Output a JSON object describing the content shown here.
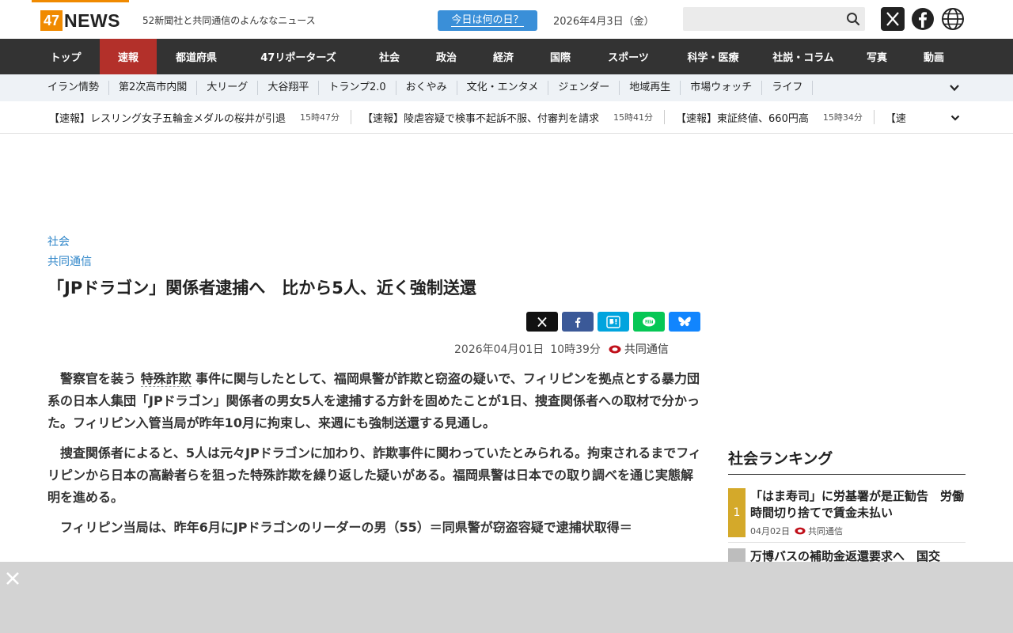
{
  "header": {
    "logo_num": "47",
    "logo_word": "NEWS",
    "tagline": "52新聞社と共同通信のよんななニュース",
    "today_button": "今日は何の日？",
    "date": "2026年4月3日（金）",
    "search_placeholder": ""
  },
  "main_nav": [
    {
      "label": "トップ"
    },
    {
      "label": "速報",
      "active": true
    },
    {
      "label": "都道府県"
    },
    {
      "label": "47リポーターズ"
    },
    {
      "label": "社会"
    },
    {
      "label": "政治"
    },
    {
      "label": "経済"
    },
    {
      "label": "国際"
    },
    {
      "label": "スポーツ"
    },
    {
      "label": "科学・医療"
    },
    {
      "label": "社説・コラム"
    },
    {
      "label": "写真"
    },
    {
      "label": "動画"
    }
  ],
  "sub_nav": [
    "イラン情勢",
    "第2次高市内閣",
    "大リーグ",
    "大谷翔平",
    "トランプ2.0",
    "おくやみ",
    "文化・エンタメ",
    "ジェンダー",
    "地域再生",
    "市場ウォッチ",
    "ライフ"
  ],
  "ticker": [
    {
      "title": "【速報】レスリング女子五輪金メダルの桜井が引退",
      "time": "15時47分"
    },
    {
      "title": "【速報】陵虐容疑で検事不起訴不服、付審判を請求",
      "time": "15時41分"
    },
    {
      "title": "【速報】東証終値、660円高",
      "time": "15時34分"
    },
    {
      "title": "【速",
      "time": ""
    }
  ],
  "article": {
    "category": "社会",
    "source": "共同通信",
    "title": "「JPドラゴン」関係者逮捕へ　比から5人、近く強制送還",
    "date": "2026年04月01日",
    "time": "10時39分",
    "publisher": "共同通信",
    "p1_pre": "警察官を装う ",
    "p1_kw": "特殊詐欺",
    "p1_post": " 事件に関与したとして、福岡県警が詐欺と窃盗の疑いで、フィリピンを拠点とする暴力団系の日本人集団「JPドラゴン」関係者の男女5人を逮捕する方針を固めたことが1日、捜査関係者への取材で分かった。フィリピン入管当局が昨年10月に拘束し、来週にも強制送還する見通し。",
    "p2": "捜査関係者によると、5人は元々JPドラゴンに加わり、詐欺事件に関わっていたとみられる。拘束されるまでフィリピンから日本の高齢者らを狙った特殊詐欺を繰り返した疑いがある。福岡県警は日本での取り調べを通じ実態解明を進める。",
    "p3": "フィリピン当局は、昨年6月にJPドラゴンのリーダーの男（55）＝同県警が窃盗容疑で逮捕状取得＝"
  },
  "share": {
    "x": "X",
    "fb": "f",
    "hb": "B!",
    "line": "LINE",
    "bs": "bsky"
  },
  "ranking": {
    "heading": "社会ランキング",
    "items": [
      {
        "rank": "1",
        "title": "「はま寿司」に労基署が是正勧告　労働時間切り捨てで賃金未払い",
        "date": "04月02日",
        "publisher": "共同通信"
      },
      {
        "rank": "",
        "title": "万博バスの補助金返還要求へ　国交",
        "date": "",
        "publisher": ""
      }
    ]
  },
  "colors": {
    "accent": "#f08a00",
    "active_nav": "#b3302a",
    "link": "#2f86c9",
    "rank_gold": "#d4a92a"
  }
}
